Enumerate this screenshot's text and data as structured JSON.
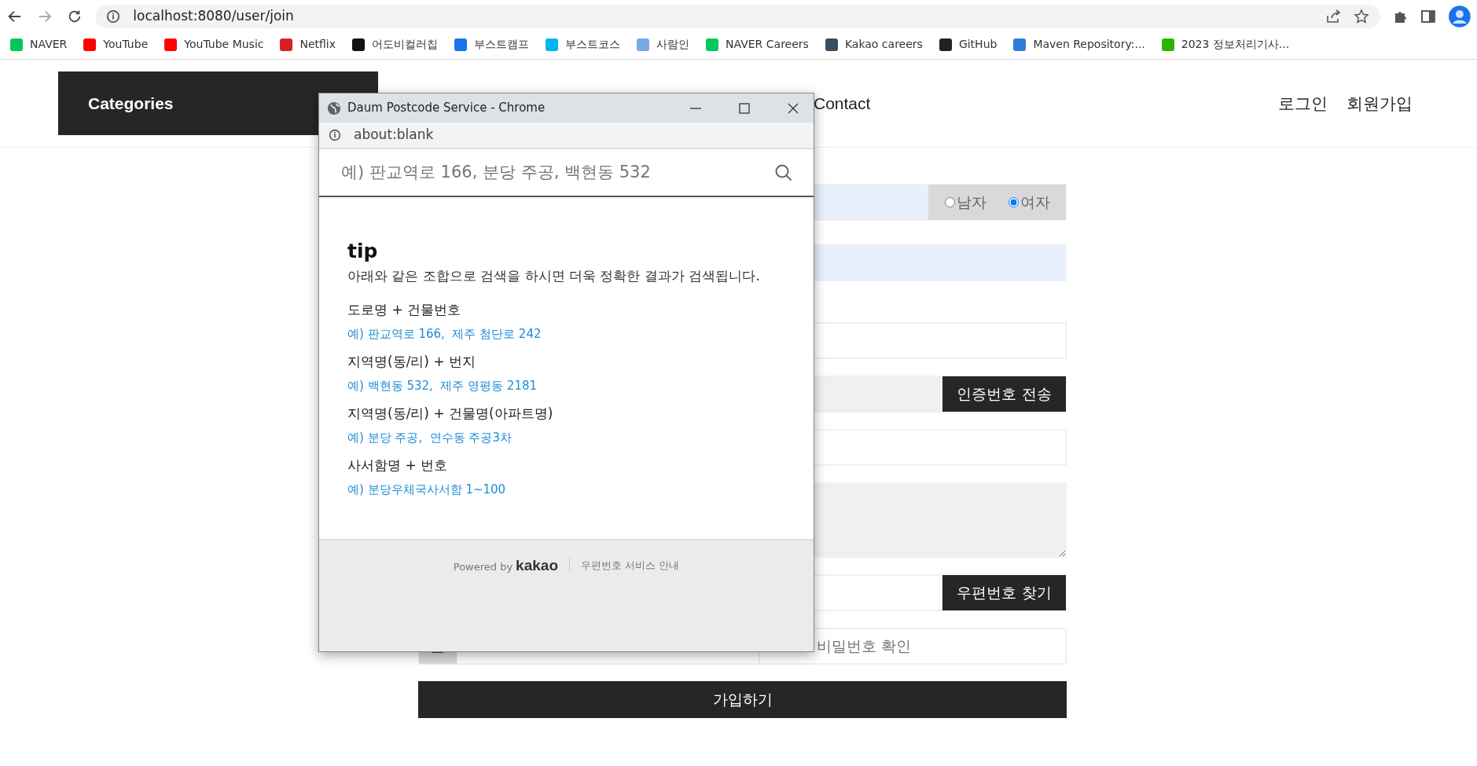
{
  "browser": {
    "url": "localhost:8080/user/join"
  },
  "bookmarks": [
    {
      "label": "NAVER",
      "color": "#03c75a"
    },
    {
      "label": "YouTube",
      "color": "#ff0000"
    },
    {
      "label": "YouTube Music",
      "color": "#ff0000"
    },
    {
      "label": "Netflix",
      "color": "#d81f26"
    },
    {
      "label": "어도비컬러칩",
      "color": "#111111"
    },
    {
      "label": "부스트캠프",
      "color": "#1a73e8"
    },
    {
      "label": "부스트코스",
      "color": "#00b4f0"
    },
    {
      "label": "사람인",
      "color": "#7aa7e8"
    },
    {
      "label": "NAVER Careers",
      "color": "#03c75a"
    },
    {
      "label": "Kakao careers",
      "color": "#3c4a63"
    },
    {
      "label": "GitHub",
      "color": "#222222"
    },
    {
      "label": "Maven Repository:...",
      "color": "#2f7bd8"
    },
    {
      "label": "2023 정보처리기사...",
      "color": "#2db400"
    }
  ],
  "header": {
    "categories": "Categories",
    "nav_links": [
      "Contact"
    ],
    "user_links": [
      "로그인",
      "회원가입"
    ]
  },
  "form": {
    "rows": [
      {
        "kind": "gender",
        "autofilled": true,
        "options": [
          {
            "label": "남자",
            "selected": false
          },
          {
            "label": "여자",
            "selected": true
          }
        ]
      },
      {
        "kind": "input",
        "autofilled": true,
        "readonly": false
      },
      {
        "kind": "input",
        "autofilled": false,
        "readonly": false
      },
      {
        "kind": "button-input",
        "readonly": true,
        "button": "인증번호 전송"
      },
      {
        "kind": "input",
        "autofilled": false,
        "readonly": false
      },
      {
        "kind": "area",
        "readonly": true
      },
      {
        "kind": "button-input",
        "readonly": false,
        "button": "우편번호 찾기"
      },
      {
        "kind": "password",
        "placeholder": "비밀번호 확인"
      }
    ],
    "submit": "가입하기"
  },
  "popup": {
    "title": "Daum Postcode Service - Chrome",
    "url": "about:blank",
    "search_placeholder": "예) 판교역로 166, 분당 주공, 백현동 532",
    "tip_heading": "tip",
    "tip_text": "아래와 같은 조합으로 검색을 하시면 더욱 정확한 결과가 검색됩니다.",
    "tips": [
      {
        "label": "도로명 + 건물번호",
        "example": "예) 판교역로 166,  제주 첨단로 242"
      },
      {
        "label": "지역명(동/리) + 번지",
        "example": "예) 백현동 532,  제주 영평동 2181"
      },
      {
        "label": "지역명(동/리) + 건물명(아파트명)",
        "example": "예) 분당 주공,  연수동 주공3차"
      },
      {
        "label": "사서함명 + 번호",
        "example": "예) 분당우체국사서함 1~100"
      }
    ],
    "footer": {
      "powered_by": "Powered by",
      "brand": "kakao",
      "link": "우편번호 서비스 안내"
    }
  }
}
